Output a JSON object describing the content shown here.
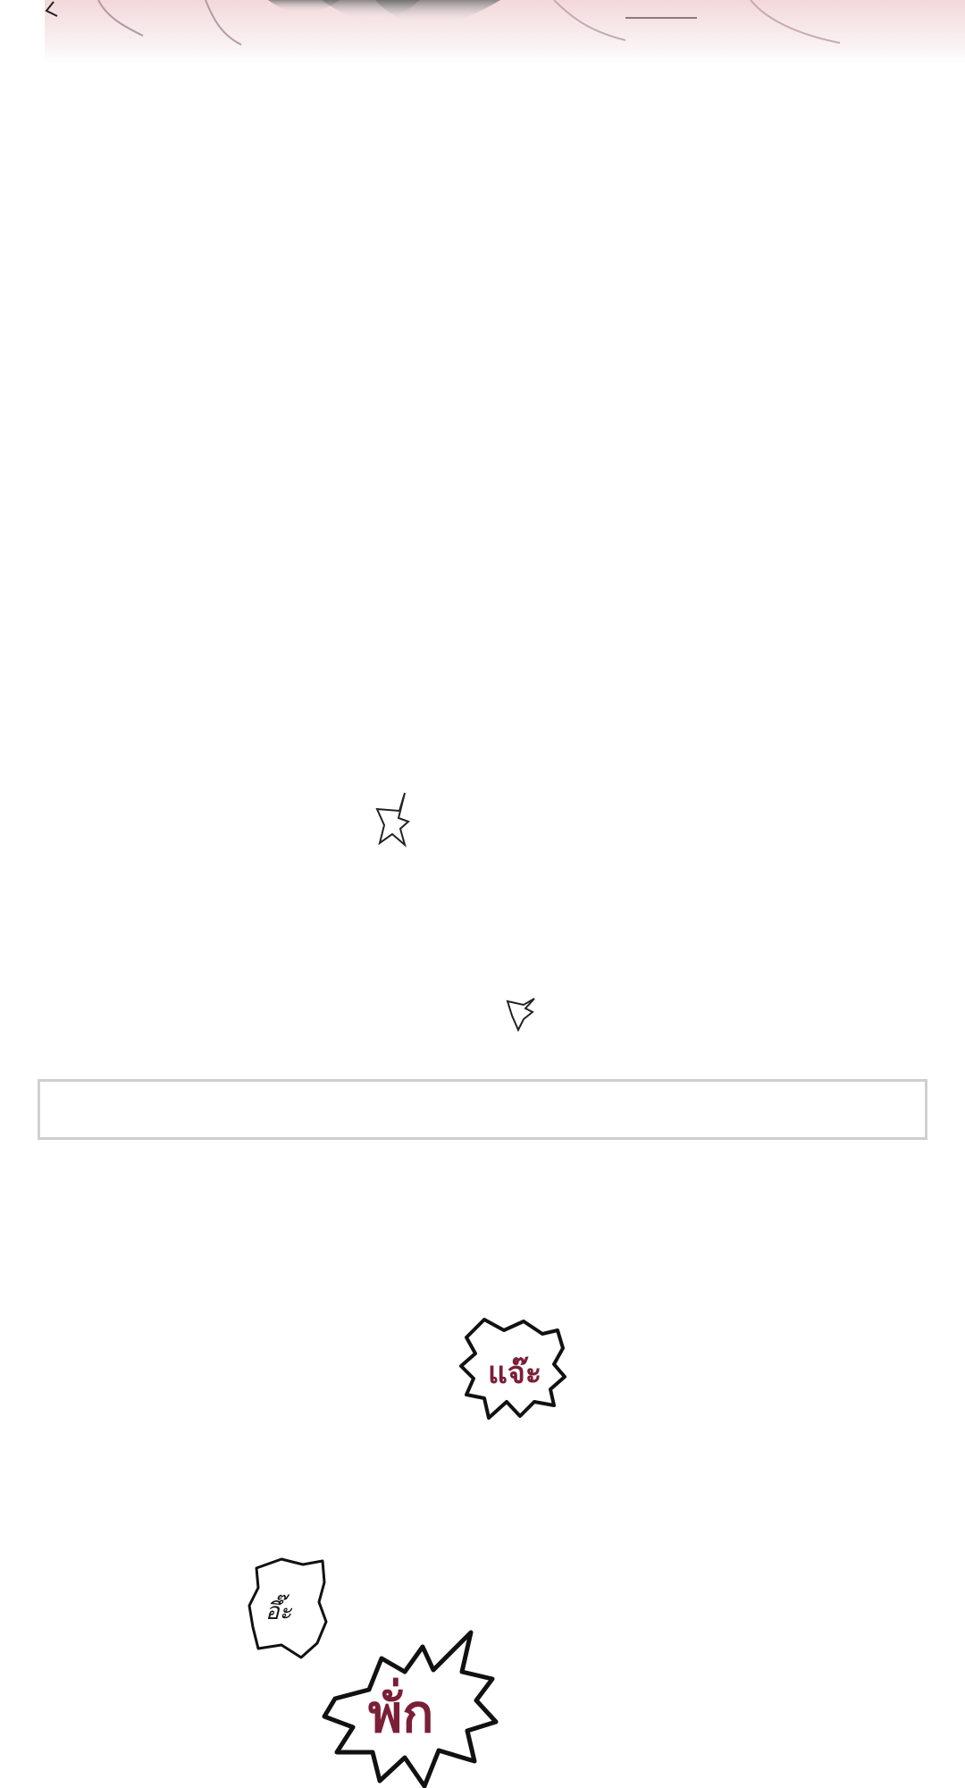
{
  "sfx": {
    "slap_small": "แจ๊ะ",
    "gasp": "อึ๊ะ",
    "thud": "พั่ก"
  },
  "colors": {
    "sfx_red": "#7a1f36",
    "box_border": "#cfcfcf",
    "top_tint": "#f2d6d8"
  }
}
